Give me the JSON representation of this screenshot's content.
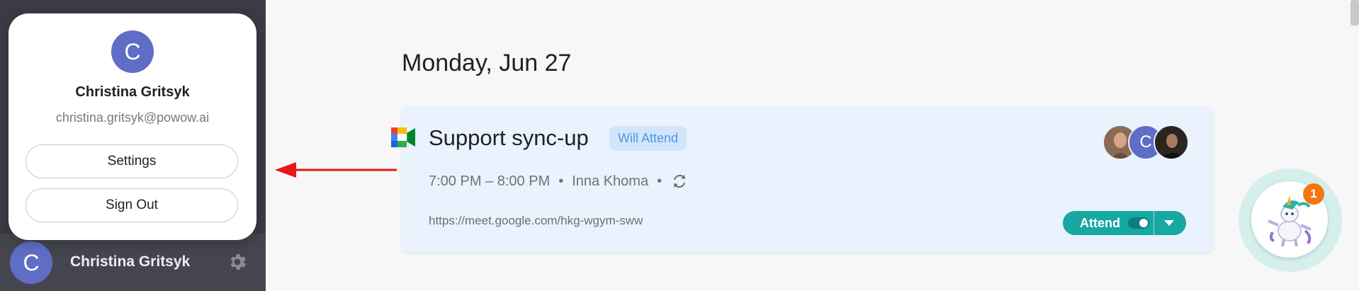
{
  "sidebar": {
    "user_initial": "C",
    "user_name": "Christina Gritsyk",
    "settings_icon": "gear-icon"
  },
  "popup": {
    "initial": "C",
    "name": "Christina Gritsyk",
    "email": "christina.gritsyk@powow.ai",
    "settings_label": "Settings",
    "signout_label": "Sign Out"
  },
  "main": {
    "day_heading": "Monday, Jun 27",
    "event": {
      "title": "Support sync-up",
      "status": "Will Attend",
      "time": "7:00 PM – 8:00 PM",
      "separator": "•",
      "organizer": "Inna Khoma",
      "link": "https://meet.google.com/hkg-wgym-sww",
      "attend_label": "Attend",
      "attendee_initial": "C"
    }
  },
  "assistant": {
    "notification_count": "1"
  },
  "colors": {
    "sidebar_bg": "#3b3b46",
    "avatar": "#5f6dc5",
    "card_bg": "#e9f2fd",
    "badge_text": "#4a9be8",
    "attend_bg": "#17a8a2",
    "arrow": "#e8161a",
    "notif": "#f5760f"
  }
}
